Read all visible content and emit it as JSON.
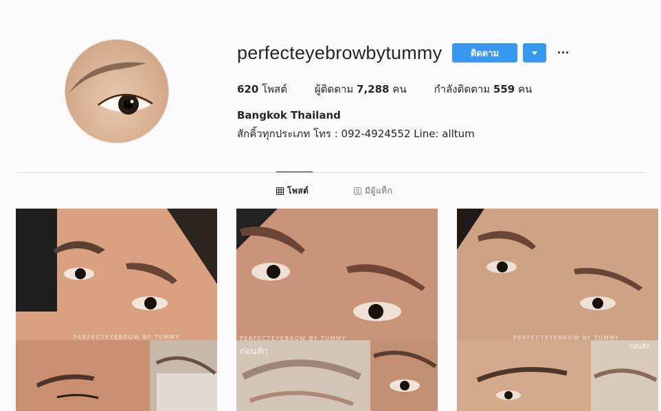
{
  "profile": {
    "username": "perfecteyebrowbytummy",
    "follow_label": "ติดตาม",
    "stats": {
      "posts_count": "620",
      "posts_label": "โพสต์",
      "followers_label": "ผู้ติดตาม",
      "followers_count": "7,288",
      "followers_unit": "คน",
      "following_label": "กำลังติดตาม",
      "following_count": "559",
      "following_unit": "คน"
    },
    "full_name": "Bangkok Thailand",
    "bio": "สักคิ้วทุกประเภท โทร : 092-4924552 Line: alltum"
  },
  "tabs": [
    {
      "label": "โพสต์",
      "icon": "grid-icon",
      "active": true
    },
    {
      "label": "มีผู้แท็ก",
      "icon": "tagged-icon",
      "active": false
    }
  ],
  "posts": [
    {
      "watermark": "PERFECTEYEBROW BY TUMMY",
      "caption": ""
    },
    {
      "watermark": "PERFECTEYEBROW BY TUMMY",
      "caption": "ก่อนสัก"
    },
    {
      "watermark": "PERFECTEYEBROW BY TUMMY",
      "caption": "ก่อนสัก"
    }
  ],
  "colors": {
    "accent": "#3897f0",
    "background": "#fafafa",
    "text": "#262626",
    "muted": "#999999",
    "divider": "#dbdbdb"
  }
}
